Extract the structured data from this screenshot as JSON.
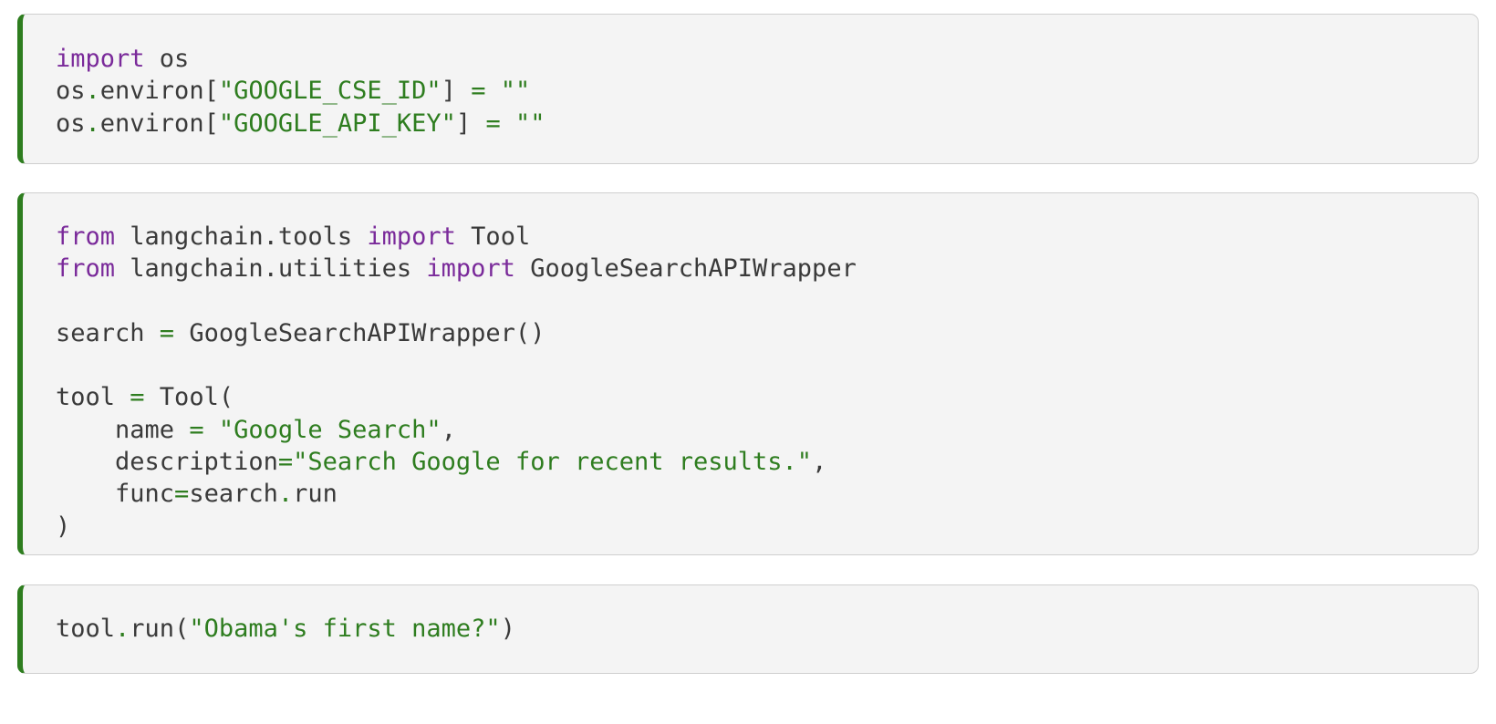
{
  "cells": [
    {
      "lines": [
        [
          [
            "kw",
            "import"
          ],
          [
            "plain",
            " os"
          ]
        ],
        [
          [
            "plain",
            "os"
          ],
          [
            "op",
            "."
          ],
          [
            "plain",
            "environ["
          ],
          [
            "str",
            "\"GOOGLE_CSE_ID\""
          ],
          [
            "plain",
            "] "
          ],
          [
            "op",
            "="
          ],
          [
            "plain",
            " "
          ],
          [
            "str",
            "\"\""
          ]
        ],
        [
          [
            "plain",
            "os"
          ],
          [
            "op",
            "."
          ],
          [
            "plain",
            "environ["
          ],
          [
            "str",
            "\"GOOGLE_API_KEY\""
          ],
          [
            "plain",
            "] "
          ],
          [
            "op",
            "="
          ],
          [
            "plain",
            " "
          ],
          [
            "str",
            "\"\""
          ]
        ]
      ]
    },
    {
      "lines": [
        [
          [
            "kw",
            "from"
          ],
          [
            "plain",
            " langchain.tools "
          ],
          [
            "kw",
            "import"
          ],
          [
            "plain",
            " Tool"
          ]
        ],
        [
          [
            "kw",
            "from"
          ],
          [
            "plain",
            " langchain.utilities "
          ],
          [
            "kw",
            "import"
          ],
          [
            "plain",
            " GoogleSearchAPIWrapper"
          ]
        ],
        [],
        [
          [
            "plain",
            "search "
          ],
          [
            "op",
            "="
          ],
          [
            "plain",
            " GoogleSearchAPIWrapper()"
          ]
        ],
        [],
        [
          [
            "plain",
            "tool "
          ],
          [
            "op",
            "="
          ],
          [
            "plain",
            " Tool("
          ]
        ],
        [
          [
            "plain",
            "    name "
          ],
          [
            "op",
            "="
          ],
          [
            "plain",
            " "
          ],
          [
            "str",
            "\"Google Search\""
          ],
          [
            "plain",
            ","
          ]
        ],
        [
          [
            "plain",
            "    description"
          ],
          [
            "op",
            "="
          ],
          [
            "str",
            "\"Search Google for recent results.\""
          ],
          [
            "plain",
            ","
          ]
        ],
        [
          [
            "plain",
            "    func"
          ],
          [
            "op",
            "="
          ],
          [
            "plain",
            "search"
          ],
          [
            "op",
            "."
          ],
          [
            "plain",
            "run"
          ]
        ],
        [
          [
            "plain",
            ")"
          ]
        ]
      ]
    },
    {
      "lines": [
        [
          [
            "plain",
            "tool"
          ],
          [
            "op",
            "."
          ],
          [
            "plain",
            "run("
          ],
          [
            "str",
            "\"Obama's first name?\""
          ],
          [
            "plain",
            ")"
          ]
        ]
      ]
    }
  ]
}
